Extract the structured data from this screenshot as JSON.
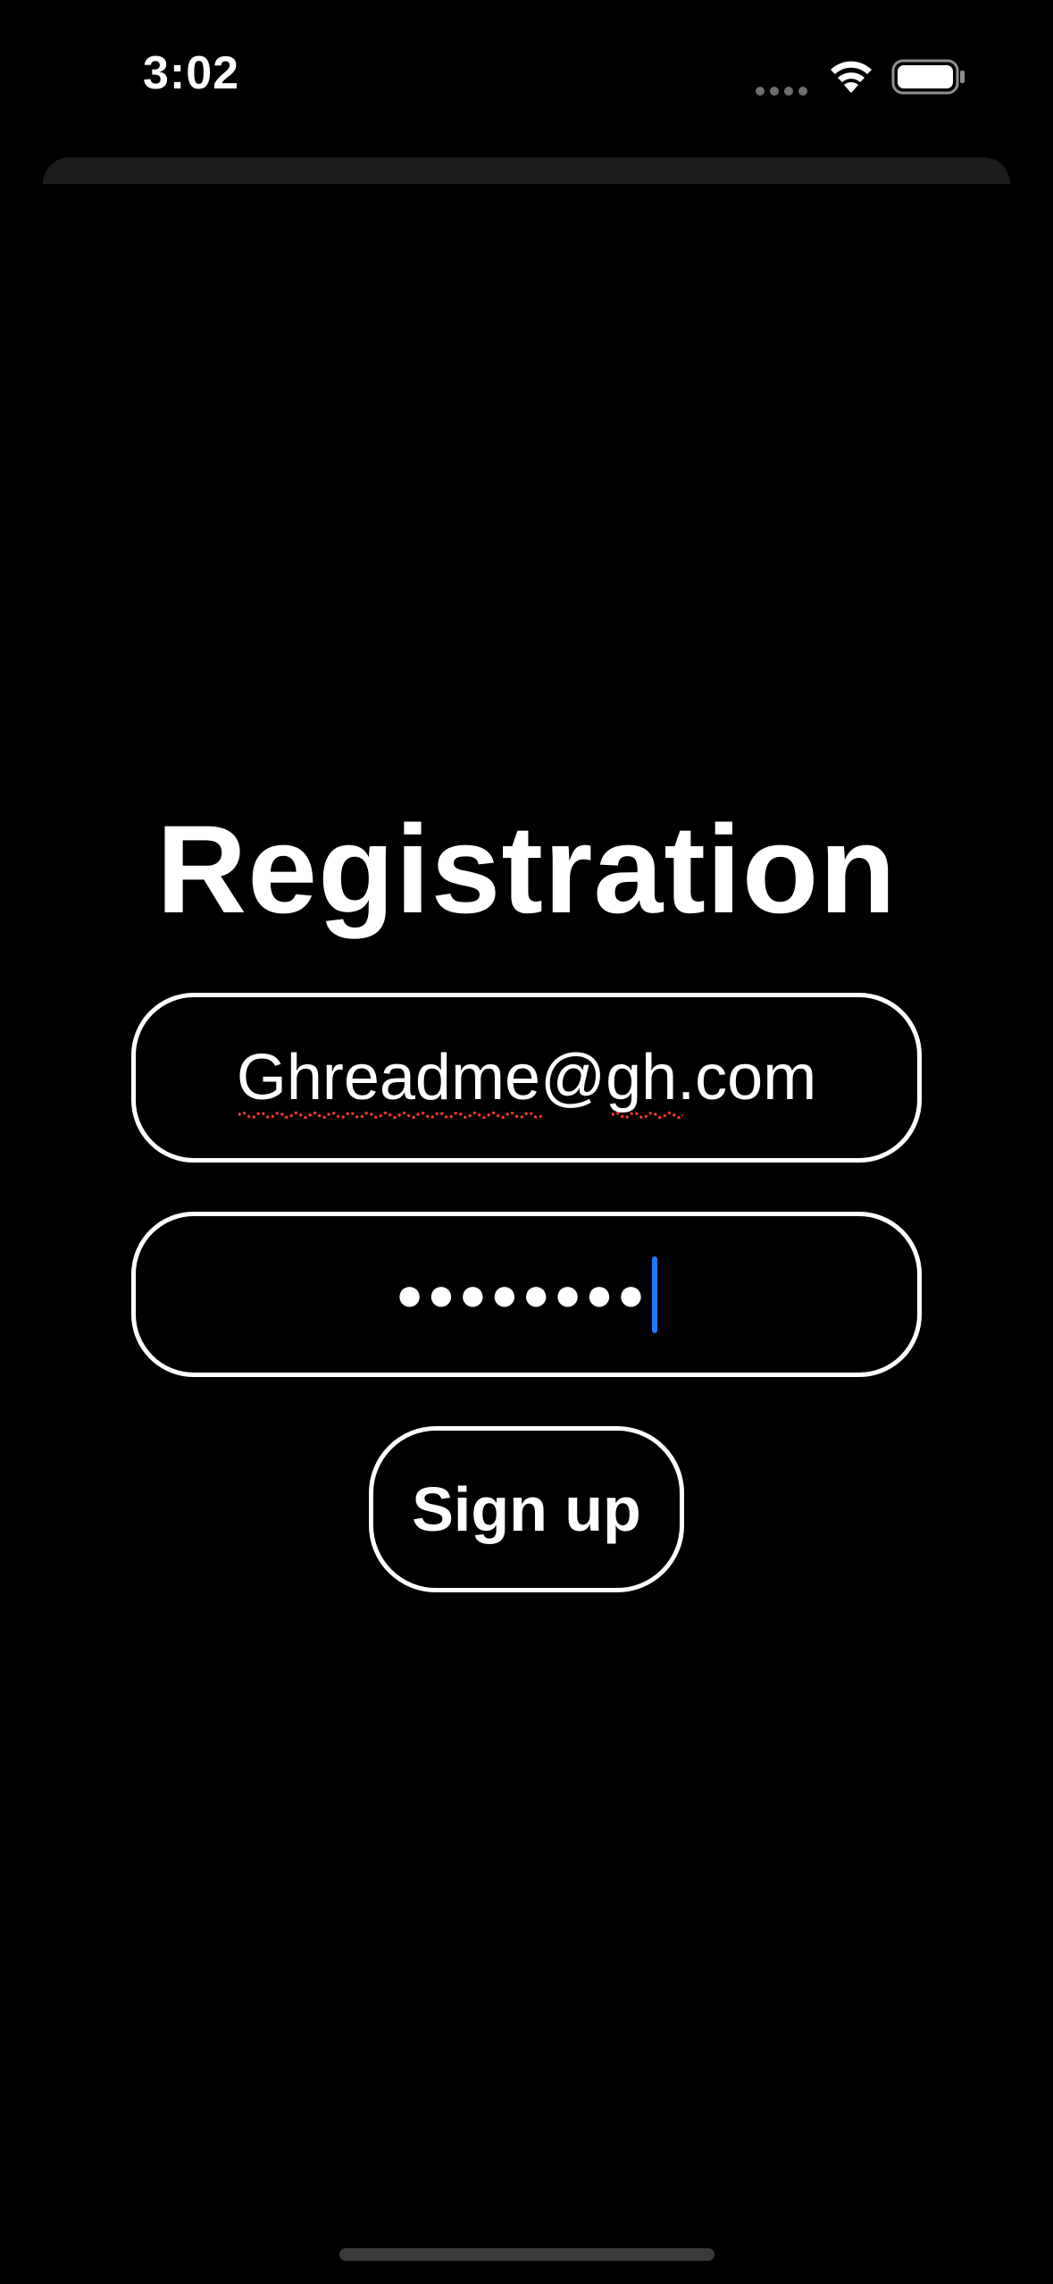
{
  "status_bar": {
    "time": "3:02",
    "icons": [
      "cellular-dots-icon",
      "wifi-icon",
      "battery-icon"
    ]
  },
  "screen": {
    "title": "Registration",
    "email_field": {
      "value": "Ghreadme@gh.com"
    },
    "password_field": {
      "masked_value": "●●●●●●●●"
    },
    "signup_button": {
      "label": "Sign up"
    }
  },
  "colors": {
    "background": "#000000",
    "foreground": "#ffffff",
    "caret": "#1a7bff",
    "spellcheck_underline": "#ff3b30"
  }
}
